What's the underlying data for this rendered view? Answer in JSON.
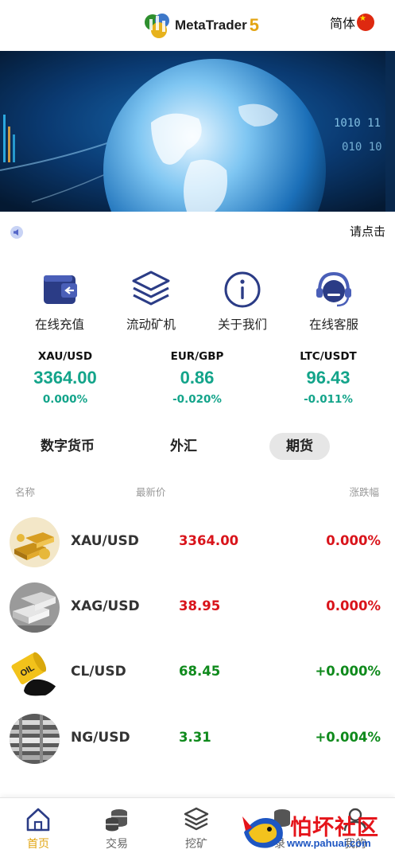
{
  "header": {
    "logo_text": "MetaTrader",
    "logo_version": "5",
    "lang_label": "简体"
  },
  "notice": {
    "text": "请点击"
  },
  "quick_actions": [
    {
      "label": "在线充值",
      "icon": "wallet-icon"
    },
    {
      "label": "流动矿机",
      "icon": "layers-icon"
    },
    {
      "label": "关于我们",
      "icon": "info-icon"
    },
    {
      "label": "在线客服",
      "icon": "headset-icon"
    }
  ],
  "tickers": [
    {
      "symbol": "XAU/USD",
      "price": "3364.00",
      "change": "0.000%"
    },
    {
      "symbol": "EUR/GBP",
      "price": "0.86",
      "change": "-0.020%"
    },
    {
      "symbol": "LTC/USDT",
      "price": "96.43",
      "change": "-0.011%"
    }
  ],
  "tabs": [
    {
      "label": "数字货币",
      "active": false
    },
    {
      "label": "外汇",
      "active": false
    },
    {
      "label": "期货",
      "active": true
    }
  ],
  "list_header": {
    "name": "名称",
    "price": "最新价",
    "change": "涨跌幅"
  },
  "rows": [
    {
      "name": "XAU/USD",
      "price": "3364.00",
      "change": "0.000%",
      "color": "red",
      "thumb": "gold-bars-image"
    },
    {
      "name": "XAG/USD",
      "price": "38.95",
      "change": "0.000%",
      "color": "red",
      "thumb": "silver-bars-image"
    },
    {
      "name": "CL/USD",
      "price": "68.45",
      "change": "+0.000%",
      "color": "green",
      "thumb": "oil-barrel-image"
    },
    {
      "name": "NG/USD",
      "price": "3.31",
      "change": "+0.004%",
      "color": "green",
      "thumb": "gas-pipeline-image"
    }
  ],
  "nav": [
    {
      "label": "首页",
      "icon": "home-icon",
      "active": true
    },
    {
      "label": "交易",
      "icon": "coins-icon",
      "active": false
    },
    {
      "label": "挖矿",
      "icon": "layers-icon",
      "active": false
    },
    {
      "label": "录",
      "icon": "coins-icon",
      "active": false
    },
    {
      "label": "我的",
      "icon": "user-icon",
      "active": false
    }
  ],
  "watermark": {
    "text": "怕坏社区",
    "url": "www.pahuai.com"
  },
  "colors": {
    "accent": "#e2a614",
    "up_green": "#13a48a",
    "red": "#d9141b",
    "green": "#0f8a1c"
  }
}
